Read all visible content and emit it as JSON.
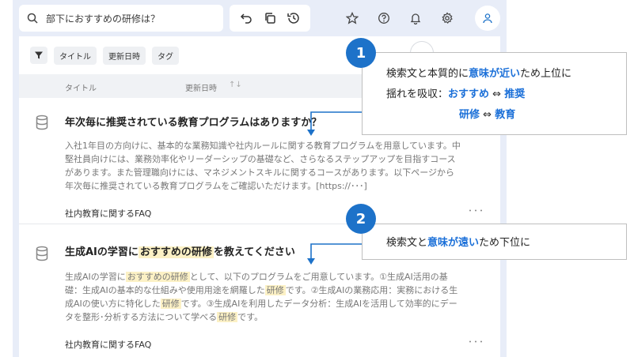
{
  "search": {
    "placeholder": "部下におすすめの研修は？"
  },
  "toolbar": {
    "icons": [
      "undo-icon",
      "copy-icon",
      "history-icon"
    ]
  },
  "header_icons": [
    "star-icon",
    "help-icon",
    "bell-icon",
    "gear-icon",
    "user-icon"
  ],
  "filters": {
    "chips": [
      "タイトル",
      "更新日時",
      "タグ"
    ]
  },
  "columns": {
    "title": "タイトル",
    "updated": "更新日時",
    "sort_glyph": "↑↓"
  },
  "results": [
    {
      "title": "年次毎に推奨されている教育プログラムはありますか？",
      "body": "入社1年目の方向けに、基本的な業務知識や社内ルールに関する教育プログラムを用意しています。中堅社員向けには、業務効率化やリーダーシップの基礎など、さらなるステップアップを目指すコースがあります。また管理職向けには、マネジメントスキルに関するコースがあります。以下ページから年次毎に推奨されている教育プログラムをご確認いただけます。[https://･･･]",
      "category": "社内教育に関するFAQ",
      "more": "･･･"
    },
    {
      "title_pre": "生成AIの学習に",
      "title_hl": "おすすめの研修",
      "title_post": "を教えてください",
      "body_1": "生成AIの学習に",
      "body_hl1": "おすすめの研修",
      "body_2": "として、以下のプログラムをご用意しています。①生成AI活用の基礎：生成AIの基本的な仕組みや使用用途を網羅した",
      "body_hl2": "研修",
      "body_3": "です。②生成AIの業務応用：実務における生成AIの使い方に特化した",
      "body_hl3": "研修",
      "body_4": "です。③生成AIを利用したデータ分析：生成AIを活用して効率的にデータを整形･分析する方法について学べる",
      "body_hl4": "研修",
      "body_5": "です。",
      "category": "社内教育に関するFAQ",
      "more": "･･･"
    }
  ],
  "callout1": {
    "number": "1",
    "l1_a": "検索文と本質的に",
    "l1_b": "意味が近い",
    "l1_c": "ため上位に",
    "l2_a": "揺れを吸収：",
    "l2_b": "おすすめ",
    "l2_c": " ⇔ ",
    "l2_d": "推奨",
    "l3_a": "研修",
    "l3_b": " ⇔ ",
    "l3_c": "教育"
  },
  "callout2": {
    "number": "2",
    "a": "検索文と",
    "b": "意味が遠い",
    "c": "ため下位に"
  },
  "colors": {
    "accent": "#1a6fd8",
    "badge": "#1d72c9",
    "highlight": "#fcf1c5",
    "frame": "#e8edf8"
  }
}
